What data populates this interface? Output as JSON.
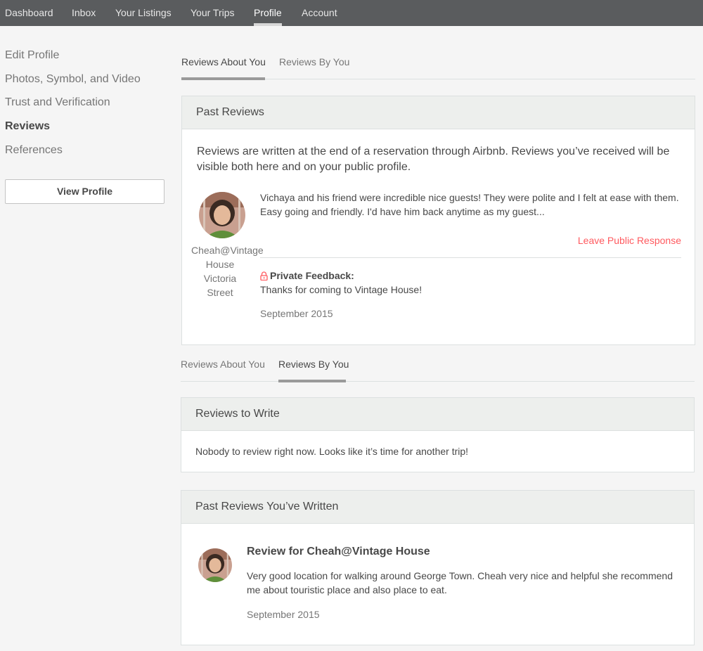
{
  "nav": {
    "items": [
      {
        "label": "Dashboard"
      },
      {
        "label": "Inbox"
      },
      {
        "label": "Your Listings"
      },
      {
        "label": "Your Trips"
      },
      {
        "label": "Profile"
      },
      {
        "label": "Account"
      }
    ]
  },
  "sidebar": {
    "items": [
      {
        "label": "Edit Profile"
      },
      {
        "label": "Photos, Symbol, and Video"
      },
      {
        "label": "Trust and Verification"
      },
      {
        "label": "Reviews"
      },
      {
        "label": "References"
      }
    ],
    "view_profile_label": "View Profile"
  },
  "tabs_about": {
    "about_label": "Reviews About You",
    "by_label": "Reviews By You"
  },
  "past_reviews": {
    "title": "Past Reviews",
    "intro": "Reviews are written at the end of a reservation through Airbnb. Reviews you’ve received will be visible both here and on your public profile.",
    "review": {
      "reviewer_line1": "Cheah@Vintage",
      "reviewer_line2": "House",
      "reviewer_line3": "Victoria",
      "reviewer_line4": "Street",
      "text": "Vichaya and his friend were incredible nice guests! They were polite and I felt at ease with them. Easy going and friendly. I'd have him back anytime as my guest...",
      "leave_response_label": "Leave Public Response",
      "private_feedback_label": "Private Feedback:",
      "private_feedback_text": "Thanks for coming to Vintage House!",
      "date": "September 2015"
    }
  },
  "tabs_by": {
    "about_label": "Reviews About You",
    "by_label": "Reviews By You"
  },
  "reviews_to_write": {
    "title": "Reviews to Write",
    "empty_text": "Nobody to review right now. Looks like it’s time for another trip!"
  },
  "past_written": {
    "title": "Past Reviews You’ve Written",
    "review": {
      "heading": "Review for Cheah@Vintage House",
      "text": "Very good location for walking around George Town. Cheah very nice and helpful she recommend me about touristic place and also place to eat.",
      "date": "September 2015"
    }
  },
  "colors": {
    "nav_bg": "#5a5c5e",
    "accent_red": "#ff5a5f",
    "panel_header_bg": "#edefed",
    "page_bg": "#f5f5f5"
  },
  "icons": {
    "lock": "lock-icon"
  }
}
